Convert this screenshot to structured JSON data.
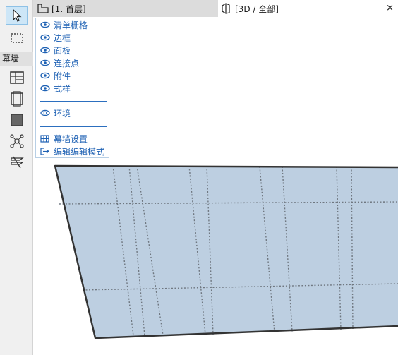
{
  "toolbox": {
    "section_label": "幕墙",
    "tools": [
      {
        "name": "arrow-tool",
        "active": true
      },
      {
        "name": "marquee-tool",
        "active": false
      },
      {
        "name": "curtain-wall-tool",
        "active": false
      },
      {
        "name": "frame-tool",
        "active": false
      },
      {
        "name": "panel-tool",
        "active": false
      },
      {
        "name": "junction-tool",
        "active": false
      },
      {
        "name": "accessory-tool",
        "active": false
      }
    ]
  },
  "tabs": [
    {
      "label": "[1. 首层]",
      "icon": "floor-plan-icon",
      "active": false
    },
    {
      "label": "[3D / 全部]",
      "icon": "3d-view-icon",
      "active": true
    }
  ],
  "close_glyph": "×",
  "menu": {
    "visibility_items": [
      {
        "label": "清单栅格",
        "icon": "eye-icon"
      },
      {
        "label": "边框",
        "icon": "eye-icon"
      },
      {
        "label": "面板",
        "icon": "eye-icon"
      },
      {
        "label": "连接点",
        "icon": "eye-icon"
      },
      {
        "label": "附件",
        "icon": "eye-icon"
      },
      {
        "label": "式样",
        "icon": "eye-icon"
      }
    ],
    "environment_item": {
      "label": "环境",
      "icon": "eye-outline-icon"
    },
    "settings_item": {
      "label": "幕墙设置",
      "icon": "curtain-wall-settings-icon"
    },
    "edit_item": {
      "label": "编辑编辑模式",
      "icon": "exit-edit-mode-icon"
    }
  },
  "colors": {
    "accent": "#1f62b4",
    "panel_fill": "#bdcfe1",
    "frame_stroke": "#333333",
    "toolbar_bg": "#f0f0f0",
    "active_tool_bg": "#cde6f7"
  }
}
